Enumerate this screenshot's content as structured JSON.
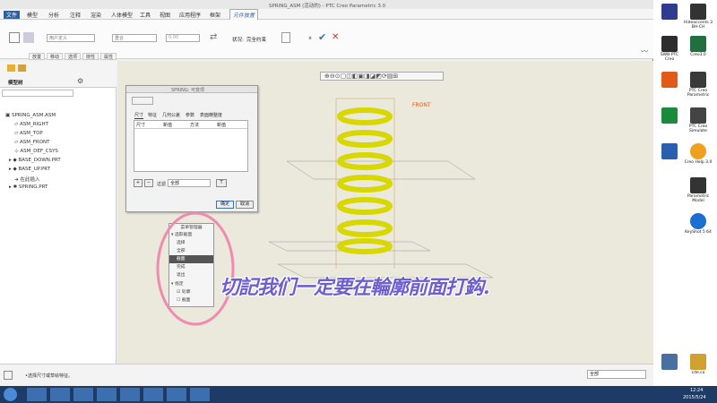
{
  "window": {
    "title": "SPRING_ASM (活动的) - PTC Creo Parametric 3.0"
  },
  "menubar": {
    "file": "文件",
    "items": [
      "模型",
      "分析",
      "注释",
      "渲染",
      "人体模型",
      "工具",
      "视图",
      "应用程序",
      "框架"
    ],
    "active": "元件放置"
  },
  "ribbon": {
    "placement_dropdown": "用户定义",
    "constraint_dropdown": "重合",
    "offset_value": "0.00",
    "status_label": "状况:",
    "status_value": "完全约束"
  },
  "subtabs": [
    "放置",
    "移动",
    "选项",
    "挠性",
    "属性"
  ],
  "left_panel": {
    "title": "模型树",
    "tree": [
      "SPRING_ASM.ASM",
      "ASM_RIGHT",
      "ASM_TOP",
      "ASM_FRONT",
      "ASM_DEF_CSYS",
      "BASE_DOWN.PRT",
      "BASE_UP.PRT",
      "在此插入",
      "SPRING.PRT"
    ]
  },
  "viewport": {
    "datum_label": "FRONT"
  },
  "dialog": {
    "title": "SPRING: 可变项",
    "tabs": [
      "尺寸",
      "特征",
      "几何公差",
      "参数",
      "表面精整度"
    ],
    "columns": [
      "尺寸",
      "新值",
      "方法",
      "新值"
    ],
    "filter_label": "过滤",
    "filter_value": "全部",
    "ok": "确定",
    "cancel": "取消"
  },
  "menu_manager": {
    "title": "菜单管理器",
    "section1": "选取截面",
    "items": [
      "选择",
      "全部",
      "截面",
      "完成",
      "退出"
    ],
    "section2": "指定",
    "options": [
      "轮廓",
      "截面"
    ],
    "selected_index": 2
  },
  "overlay_text": "切記我们一定要在輪廓前面打鈎.",
  "statusbar": {
    "message": "•选择尺寸或草绘特征。",
    "filter": "全部"
  },
  "taskbar": {
    "time": "12:24",
    "date": "2015/5/24"
  },
  "desktop": {
    "icons": [
      "Hideaccents 3 BH-CH",
      "Creo3.0",
      "SWB-PTC Creo",
      "PTC Creo Parametric",
      "PTC Creo Simulate",
      "Creo Help 3.0",
      "Parametric Model",
      "KeyShot 5 64",
      "cde.co",
      "回收站"
    ]
  },
  "colors": {
    "spring": "#d8d800",
    "overlay_text": "#6d5fcf",
    "circle": "#f08ab0",
    "active_tab": "#2e5f9f"
  }
}
